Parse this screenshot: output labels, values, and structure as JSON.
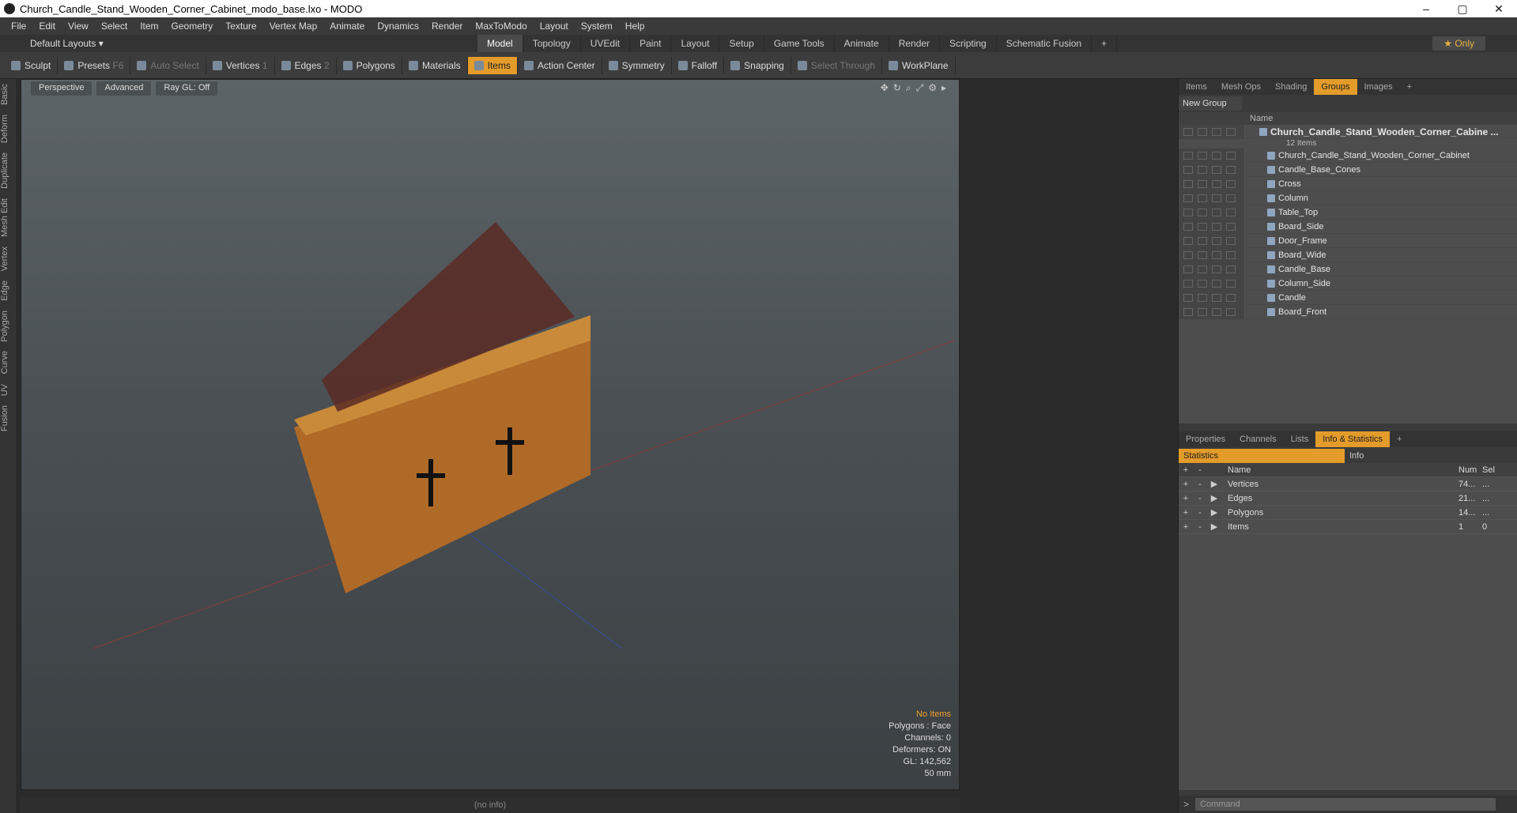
{
  "window": {
    "title": "Church_Candle_Stand_Wooden_Corner_Cabinet_modo_base.lxo - MODO",
    "min": "–",
    "max": "▢",
    "close": "✕"
  },
  "menu": [
    "File",
    "Edit",
    "View",
    "Select",
    "Item",
    "Geometry",
    "Texture",
    "Vertex Map",
    "Animate",
    "Dynamics",
    "Render",
    "MaxToModo",
    "Layout",
    "System",
    "Help"
  ],
  "layout": {
    "dropdown": "Default Layouts ▾",
    "only": "★ Only",
    "tabs": [
      "Model",
      "Topology",
      "UVEdit",
      "Paint",
      "Layout",
      "Setup",
      "Game Tools",
      "Animate",
      "Render",
      "Scripting",
      "Schematic Fusion",
      "+"
    ],
    "active": "Model"
  },
  "toolbar": {
    "sculpt": "Sculpt",
    "presets": "Presets",
    "presets_key": "F6",
    "auto_select": "Auto Select",
    "vertices": "Vertices",
    "vertices_n": "1",
    "edges": "Edges",
    "edges_n": "2",
    "polygons": "Polygons",
    "materials": "Materials",
    "items": "Items",
    "action_center": "Action Center",
    "symmetry": "Symmetry",
    "falloff": "Falloff",
    "snapping": "Snapping",
    "select_through": "Select Through",
    "workplane": "WorkPlane"
  },
  "sidebar": [
    "Basic",
    "Deform",
    "Duplicate",
    "Mesh Edit",
    "Vertex",
    "Edge",
    "Polygon",
    "Curve",
    "UV",
    "Fusion"
  ],
  "viewport": {
    "view": "Perspective",
    "mode": "Advanced",
    "raygl": "Ray GL: Off",
    "info": {
      "items": "No Items",
      "polygons": "Polygons : Face",
      "channels": "Channels: 0",
      "deformers": "Deformers: ON",
      "gl": "GL: 142,562",
      "scale": "50 mm"
    },
    "status": "(no info)"
  },
  "groups": {
    "tabs": [
      "Items",
      "Mesh Ops",
      "Shading",
      "Groups",
      "Images",
      "+"
    ],
    "active": "Groups",
    "new_group": "New Group",
    "col_name": "Name",
    "root": "Church_Candle_Stand_Wooden_Corner_Cabine ...",
    "root_sub": "12 Items",
    "items": [
      "Church_Candle_Stand_Wooden_Corner_Cabinet",
      "Candle_Base_Cones",
      "Cross",
      "Column",
      "Table_Top",
      "Board_Side",
      "Door_Frame",
      "Board_Wide",
      "Candle_Base",
      "Column_Side",
      "Candle",
      "Board_Front"
    ]
  },
  "props": {
    "tabs": [
      "Properties",
      "Channels",
      "Lists",
      "Info & Statistics",
      "+"
    ],
    "active": "Info & Statistics",
    "stats_tab": "Statistics",
    "info_tab": "Info",
    "cols": {
      "name": "Name",
      "num": "Num",
      "sel": "Sel"
    },
    "rows": [
      {
        "name": "Vertices",
        "num": "74...",
        "sel": "..."
      },
      {
        "name": "Edges",
        "num": "21...",
        "sel": "..."
      },
      {
        "name": "Polygons",
        "num": "14...",
        "sel": "..."
      },
      {
        "name": "Items",
        "num": "1",
        "sel": "0"
      }
    ]
  },
  "command": {
    "placeholder": "Command",
    "prompt": ">"
  }
}
